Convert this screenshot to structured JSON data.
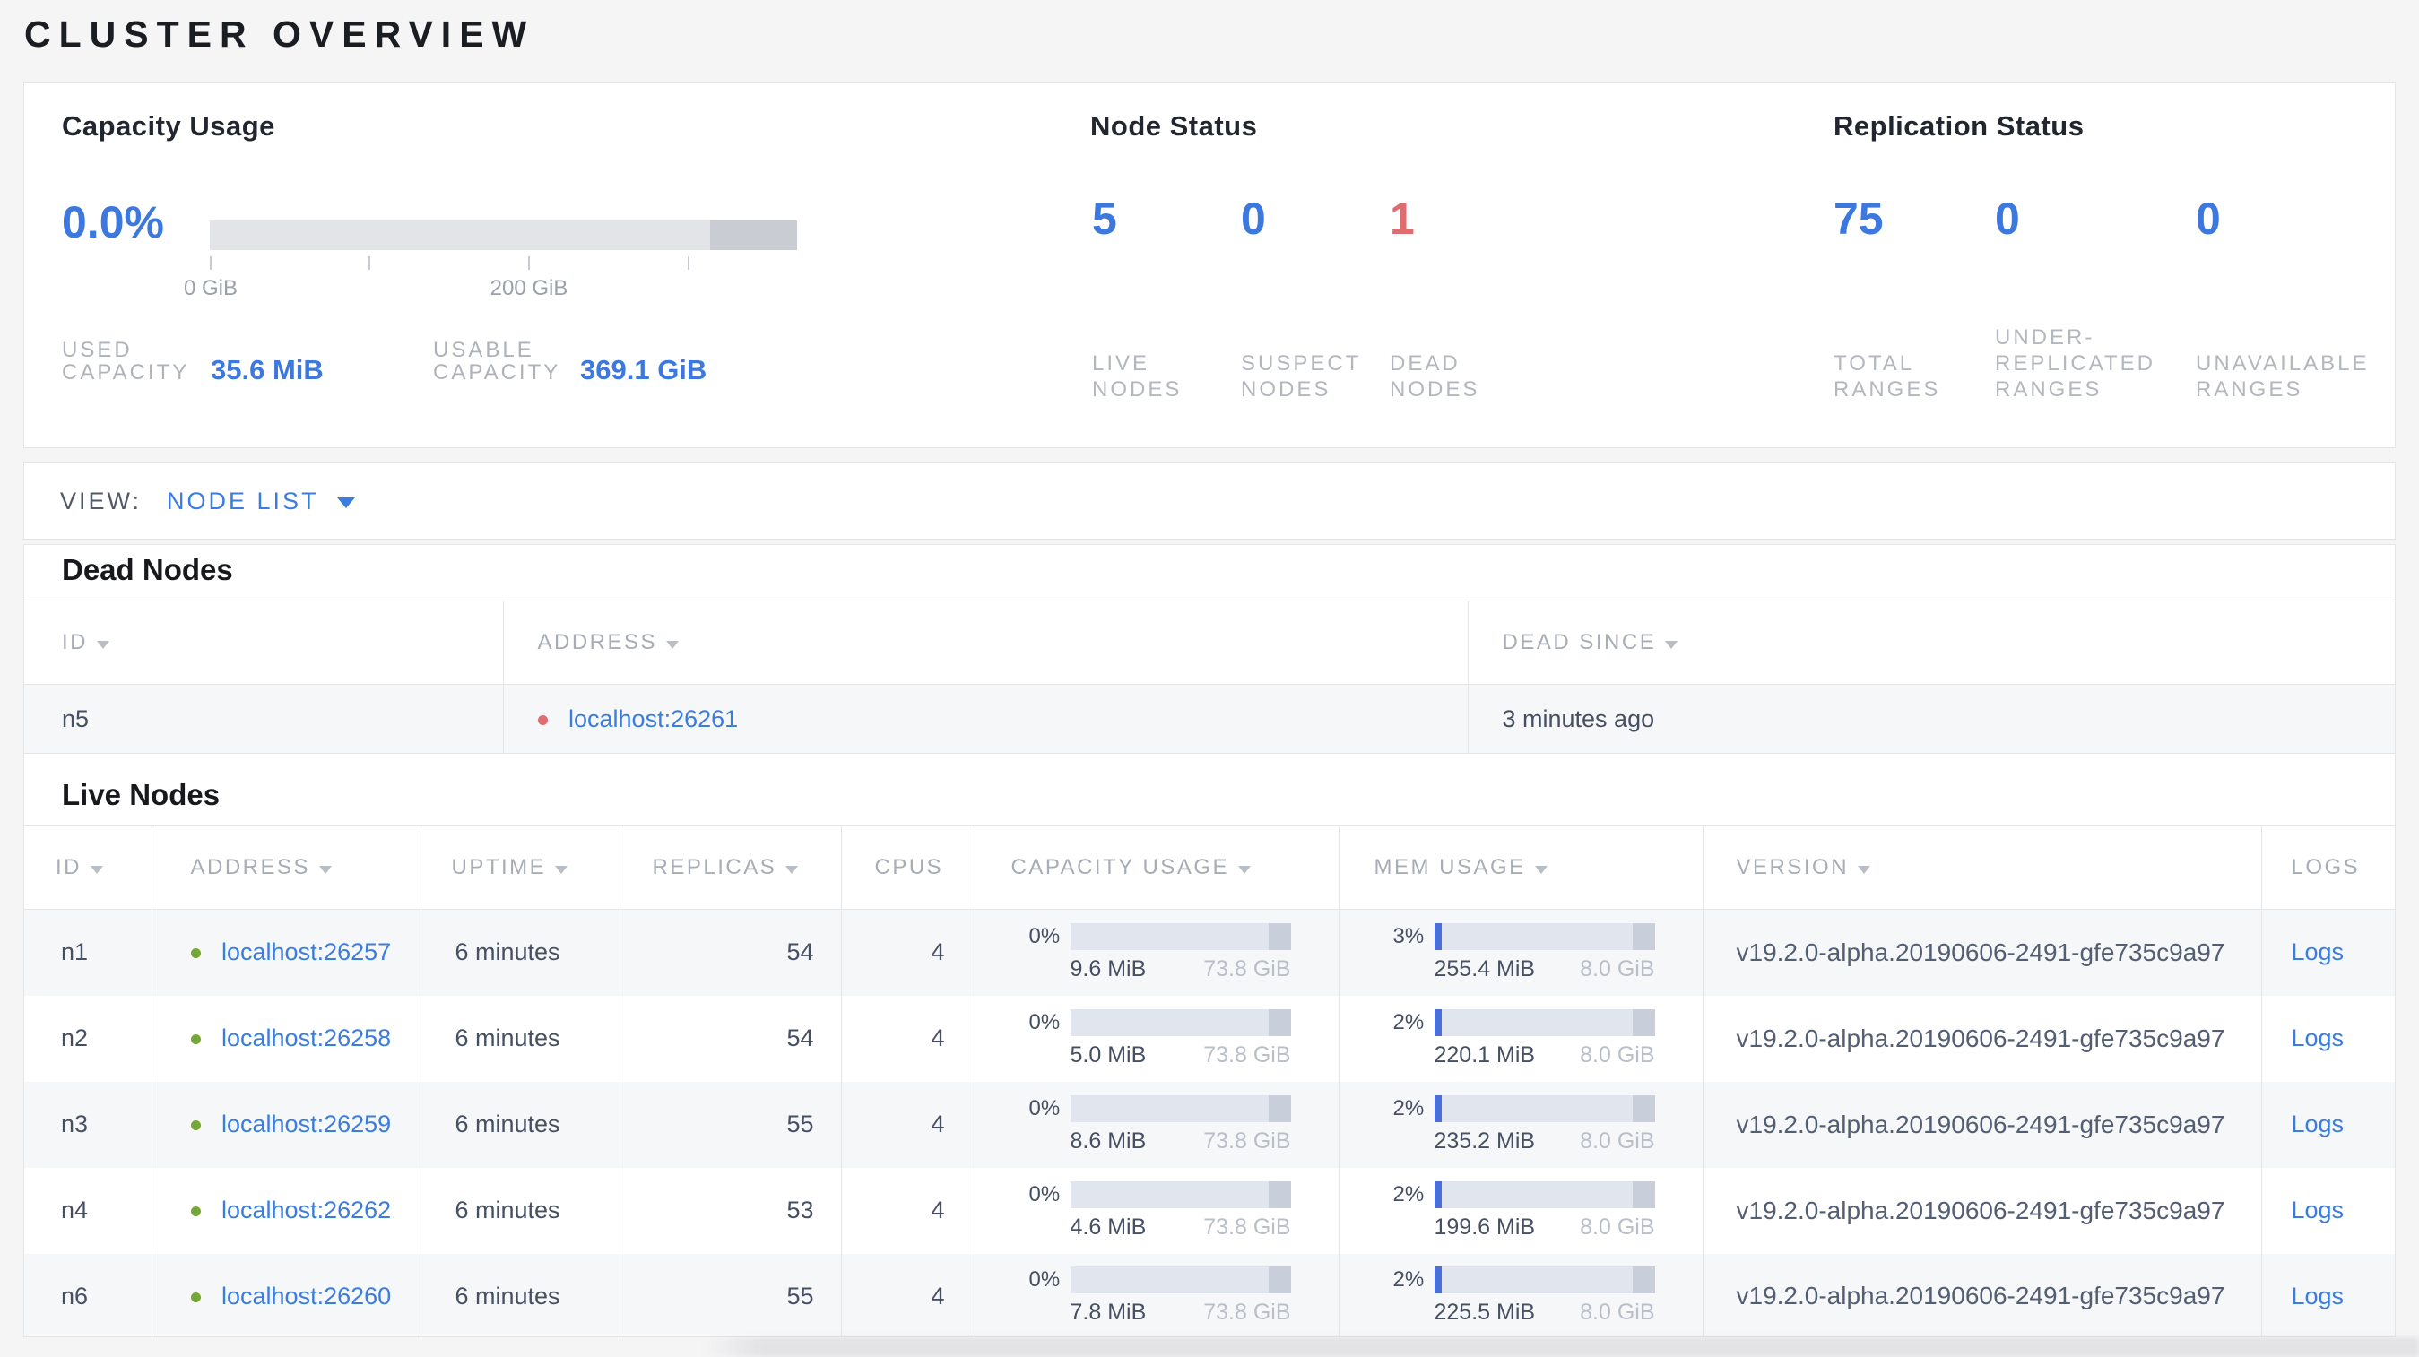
{
  "colors": {
    "accent-blue": "#3d78de",
    "link-blue": "#3a7ce0",
    "dead-red": "#df6d6f",
    "live-green": "#77a63a",
    "bar-used": "#4a6fd8"
  },
  "page": {
    "title": "CLUSTER OVERVIEW"
  },
  "summary": {
    "capacity": {
      "title": "Capacity Usage",
      "percent": "0.0%",
      "used_frac": 0,
      "tick_labels": [
        "0 GiB",
        "200 GiB"
      ],
      "stats": [
        {
          "label_lines": [
            "USED",
            "CAPACITY"
          ],
          "value": "35.6 MiB"
        },
        {
          "label_lines": [
            "USABLE",
            "CAPACITY"
          ],
          "value": "369.1 GiB"
        }
      ]
    },
    "node_status": {
      "title": "Node Status",
      "stats": [
        {
          "value": "5",
          "label_lines": [
            "LIVE",
            "NODES"
          ]
        },
        {
          "value": "0",
          "label_lines": [
            "SUSPECT",
            "NODES"
          ]
        },
        {
          "value": "1",
          "label_lines": [
            "DEAD",
            "NODES"
          ]
        }
      ]
    },
    "replication": {
      "title": "Replication Status",
      "stats": [
        {
          "value": "75",
          "label_lines": [
            "TOTAL",
            "RANGES"
          ]
        },
        {
          "value": "0",
          "label_lines": [
            "UNDER-",
            "REPLICATED",
            "RANGES"
          ]
        },
        {
          "value": "0",
          "label_lines": [
            "UNAVAILABLE",
            "RANGES"
          ]
        }
      ]
    }
  },
  "view_bar": {
    "label": "VIEW:",
    "selected": "NODE LIST"
  },
  "dead_nodes": {
    "heading": "Dead Nodes",
    "columns": {
      "id": "ID",
      "address": "ADDRESS",
      "dead_since": "DEAD SINCE"
    },
    "rows": [
      {
        "id": "n5",
        "address": "localhost:26261",
        "dead_since": "3 minutes ago"
      }
    ]
  },
  "live_nodes": {
    "heading": "Live Nodes",
    "columns": {
      "id": "ID",
      "address": "ADDRESS",
      "uptime": "UPTIME",
      "replicas": "REPLICAS",
      "cpus": "CPUS",
      "capacity": "CAPACITY USAGE",
      "mem": "MEM USAGE",
      "version": "VERSION",
      "logs": "LOGS"
    },
    "rows": [
      {
        "id": "n1",
        "address": "localhost:26257",
        "uptime": "6 minutes",
        "replicas": "54",
        "cpus": "4",
        "capacity": {
          "percent": "0%",
          "frac": 0,
          "used": "9.6 MiB",
          "total": "73.8 GiB"
        },
        "mem": {
          "percent": "3%",
          "frac": 0.03,
          "used": "255.4 MiB",
          "total": "8.0 GiB"
        },
        "version": "v19.2.0-alpha.20190606-2491-gfe735c9a97",
        "logs_label": "Logs"
      },
      {
        "id": "n2",
        "address": "localhost:26258",
        "uptime": "6 minutes",
        "replicas": "54",
        "cpus": "4",
        "capacity": {
          "percent": "0%",
          "frac": 0,
          "used": "5.0 MiB",
          "total": "73.8 GiB"
        },
        "mem": {
          "percent": "2%",
          "frac": 0.02,
          "used": "220.1 MiB",
          "total": "8.0 GiB"
        },
        "version": "v19.2.0-alpha.20190606-2491-gfe735c9a97",
        "logs_label": "Logs"
      },
      {
        "id": "n3",
        "address": "localhost:26259",
        "uptime": "6 minutes",
        "replicas": "55",
        "cpus": "4",
        "capacity": {
          "percent": "0%",
          "frac": 0,
          "used": "8.6 MiB",
          "total": "73.8 GiB"
        },
        "mem": {
          "percent": "2%",
          "frac": 0.02,
          "used": "235.2 MiB",
          "total": "8.0 GiB"
        },
        "version": "v19.2.0-alpha.20190606-2491-gfe735c9a97",
        "logs_label": "Logs"
      },
      {
        "id": "n4",
        "address": "localhost:26262",
        "uptime": "6 minutes",
        "replicas": "53",
        "cpus": "4",
        "capacity": {
          "percent": "0%",
          "frac": 0,
          "used": "4.6 MiB",
          "total": "73.8 GiB"
        },
        "mem": {
          "percent": "2%",
          "frac": 0.02,
          "used": "199.6 MiB",
          "total": "8.0 GiB"
        },
        "version": "v19.2.0-alpha.20190606-2491-gfe735c9a97",
        "logs_label": "Logs"
      },
      {
        "id": "n6",
        "address": "localhost:26260",
        "uptime": "6 minutes",
        "replicas": "55",
        "cpus": "4",
        "capacity": {
          "percent": "0%",
          "frac": 0,
          "used": "7.8 MiB",
          "total": "73.8 GiB"
        },
        "mem": {
          "percent": "2%",
          "frac": 0.02,
          "used": "225.5 MiB",
          "total": "8.0 GiB"
        },
        "version": "v19.2.0-alpha.20190606-2491-gfe735c9a97",
        "logs_label": "Logs"
      }
    ]
  }
}
